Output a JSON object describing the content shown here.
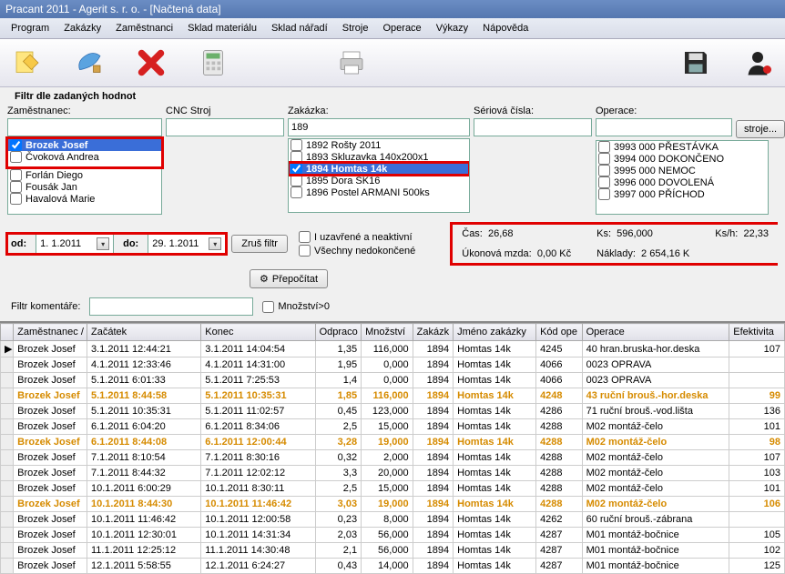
{
  "window_title": "Pracant 2011 - Agerit s. r. o. - [Načtená data]",
  "menu": [
    "Program",
    "Zakázky",
    "Zaměstnanci",
    "Sklad materiálu",
    "Sklad nářadí",
    "Stroje",
    "Operace",
    "Výkazy",
    "Nápověda"
  ],
  "filter_title": "Filtr dle zadaných hodnot",
  "filters": {
    "emp": {
      "label": "Zaměstnanec:",
      "value": ""
    },
    "cnc": {
      "label": "CNC Stroj",
      "value": ""
    },
    "order": {
      "label": "Zakázka:",
      "value": "189"
    },
    "serial": {
      "label": "Sériová čísla:",
      "value": ""
    },
    "op": {
      "label": "Operace:",
      "value": ""
    },
    "stroje_btn": "stroje..."
  },
  "emp_list": [
    {
      "checked": true,
      "label": "Brozek Josef",
      "sel": true
    },
    {
      "checked": false,
      "label": "Čvoková Andrea",
      "sel": false
    },
    {
      "checked": false,
      "label": "Forlán Diego",
      "sel": false
    },
    {
      "checked": false,
      "label": "Fousák Jan",
      "sel": false
    },
    {
      "checked": false,
      "label": "Havalová Marie",
      "sel": false
    }
  ],
  "order_list": [
    {
      "checked": false,
      "label": "1892 Rošty 2011",
      "sel": false
    },
    {
      "checked": false,
      "label": "1893 Skluzavka 140x200x1",
      "sel": false
    },
    {
      "checked": true,
      "label": "1894 Homtas 14k",
      "sel": true
    },
    {
      "checked": false,
      "label": "1895 Dora SK16",
      "sel": false
    },
    {
      "checked": false,
      "label": "1896 Postel ARMANI 500ks",
      "sel": false
    }
  ],
  "op_list": [
    {
      "checked": false,
      "label": "3993 000 PŘESTÁVKA"
    },
    {
      "checked": false,
      "label": "3994 000 DOKONČENO"
    },
    {
      "checked": false,
      "label": "3995 000 NEMOC"
    },
    {
      "checked": false,
      "label": "3996 000 DOVOLENÁ"
    },
    {
      "checked": false,
      "label": "3997 000 PŘÍCHOD"
    }
  ],
  "date": {
    "od_label": "od:",
    "od": "1. 1.2011",
    "do_label": "do:",
    "do": "29. 1.2011"
  },
  "btn_clear_filter": "Zruš filtr",
  "btn_recalc": "Přepočítat",
  "chk_closed": "I uzavřené a neaktivní",
  "chk_unfinished": "Všechny nedokončené",
  "info": {
    "time_label": "Čas:",
    "time": "26,68",
    "ks_label": "Ks:",
    "ks": "596,000",
    "ksh_label": "Ks/h:",
    "ksh": "22,33",
    "wage_label": "Úkonová mzda:",
    "wage": "0,00 Kč",
    "cost_label": "Náklady:",
    "cost": "2 654,16 K"
  },
  "comment_label": "Filtr komentáře:",
  "qty_gt0": "Množství>0",
  "grid_headers": [
    "",
    "Zaměstnanec /",
    "Začátek",
    "Konec",
    "Odpraco",
    "Množství",
    "Zakázk",
    "Jméno zakázky",
    "Kód ope",
    "Operace",
    "Efektivita"
  ],
  "rows": [
    {
      "m": "▶",
      "emp": "Brozek Josef",
      "start": "3.1.2011 12:44:21",
      "end": "3.1.2011 14:04:54",
      "work": "1,35",
      "qty": "116,000",
      "order": "1894",
      "oname": "Homtas 14k",
      "opc": "4245",
      "op": "40 hran.bruska-hor.deska",
      "eff": "107",
      "orange": false
    },
    {
      "m": "",
      "emp": "Brozek Josef",
      "start": "4.1.2011 12:33:46",
      "end": "4.1.2011 14:31:00",
      "work": "1,95",
      "qty": "0,000",
      "order": "1894",
      "oname": "Homtas 14k",
      "opc": "4066",
      "op": "0023 OPRAVA",
      "eff": "",
      "orange": false
    },
    {
      "m": "",
      "emp": "Brozek Josef",
      "start": "5.1.2011 6:01:33",
      "end": "5.1.2011 7:25:53",
      "work": "1,4",
      "qty": "0,000",
      "order": "1894",
      "oname": "Homtas 14k",
      "opc": "4066",
      "op": "0023 OPRAVA",
      "eff": "",
      "orange": false
    },
    {
      "m": "",
      "emp": "Brozek Josef",
      "start": "5.1.2011 8:44:58",
      "end": "5.1.2011 10:35:31",
      "work": "1,85",
      "qty": "116,000",
      "order": "1894",
      "oname": "Homtas 14k",
      "opc": "4248",
      "op": "43 ruční brouš.-hor.deska",
      "eff": "99",
      "orange": true
    },
    {
      "m": "",
      "emp": "Brozek Josef",
      "start": "5.1.2011 10:35:31",
      "end": "5.1.2011 11:02:57",
      "work": "0,45",
      "qty": "123,000",
      "order": "1894",
      "oname": "Homtas 14k",
      "opc": "4286",
      "op": "71 ruční brouš.-vod.lišta",
      "eff": "136",
      "orange": false
    },
    {
      "m": "",
      "emp": "Brozek Josef",
      "start": "6.1.2011 6:04:20",
      "end": "6.1.2011 8:34:06",
      "work": "2,5",
      "qty": "15,000",
      "order": "1894",
      "oname": "Homtas 14k",
      "opc": "4288",
      "op": "M02 montáž-čelo",
      "eff": "101",
      "orange": false
    },
    {
      "m": "",
      "emp": "Brozek Josef",
      "start": "6.1.2011 8:44:08",
      "end": "6.1.2011 12:00:44",
      "work": "3,28",
      "qty": "19,000",
      "order": "1894",
      "oname": "Homtas 14k",
      "opc": "4288",
      "op": "M02 montáž-čelo",
      "eff": "98",
      "orange": true
    },
    {
      "m": "",
      "emp": "Brozek Josef",
      "start": "7.1.2011 8:10:54",
      "end": "7.1.2011 8:30:16",
      "work": "0,32",
      "qty": "2,000",
      "order": "1894",
      "oname": "Homtas 14k",
      "opc": "4288",
      "op": "M02 montáž-čelo",
      "eff": "107",
      "orange": false
    },
    {
      "m": "",
      "emp": "Brozek Josef",
      "start": "7.1.2011 8:44:32",
      "end": "7.1.2011 12:02:12",
      "work": "3,3",
      "qty": "20,000",
      "order": "1894",
      "oname": "Homtas 14k",
      "opc": "4288",
      "op": "M02 montáž-čelo",
      "eff": "103",
      "orange": false
    },
    {
      "m": "",
      "emp": "Brozek Josef",
      "start": "10.1.2011 6:00:29",
      "end": "10.1.2011 8:30:11",
      "work": "2,5",
      "qty": "15,000",
      "order": "1894",
      "oname": "Homtas 14k",
      "opc": "4288",
      "op": "M02 montáž-čelo",
      "eff": "101",
      "orange": false
    },
    {
      "m": "",
      "emp": "Brozek Josef",
      "start": "10.1.2011 8:44:30",
      "end": "10.1.2011 11:46:42",
      "work": "3,03",
      "qty": "19,000",
      "order": "1894",
      "oname": "Homtas 14k",
      "opc": "4288",
      "op": "M02 montáž-čelo",
      "eff": "106",
      "orange": true
    },
    {
      "m": "",
      "emp": "Brozek Josef",
      "start": "10.1.2011 11:46:42",
      "end": "10.1.2011 12:00:58",
      "work": "0,23",
      "qty": "8,000",
      "order": "1894",
      "oname": "Homtas 14k",
      "opc": "4262",
      "op": "60 ruční brouš.-zábrana",
      "eff": "",
      "orange": false
    },
    {
      "m": "",
      "emp": "Brozek Josef",
      "start": "10.1.2011 12:30:01",
      "end": "10.1.2011 14:31:34",
      "work": "2,03",
      "qty": "56,000",
      "order": "1894",
      "oname": "Homtas 14k",
      "opc": "4287",
      "op": "M01 montáž-bočnice",
      "eff": "105",
      "orange": false
    },
    {
      "m": "",
      "emp": "Brozek Josef",
      "start": "11.1.2011 12:25:12",
      "end": "11.1.2011 14:30:48",
      "work": "2,1",
      "qty": "56,000",
      "order": "1894",
      "oname": "Homtas 14k",
      "opc": "4287",
      "op": "M01 montáž-bočnice",
      "eff": "102",
      "orange": false
    },
    {
      "m": "",
      "emp": "Brozek Josef",
      "start": "12.1.2011 5:58:55",
      "end": "12.1.2011 6:24:27",
      "work": "0,43",
      "qty": "14,000",
      "order": "1894",
      "oname": "Homtas 14k",
      "opc": "4287",
      "op": "M01 montáž-bočnice",
      "eff": "125",
      "orange": false
    }
  ]
}
